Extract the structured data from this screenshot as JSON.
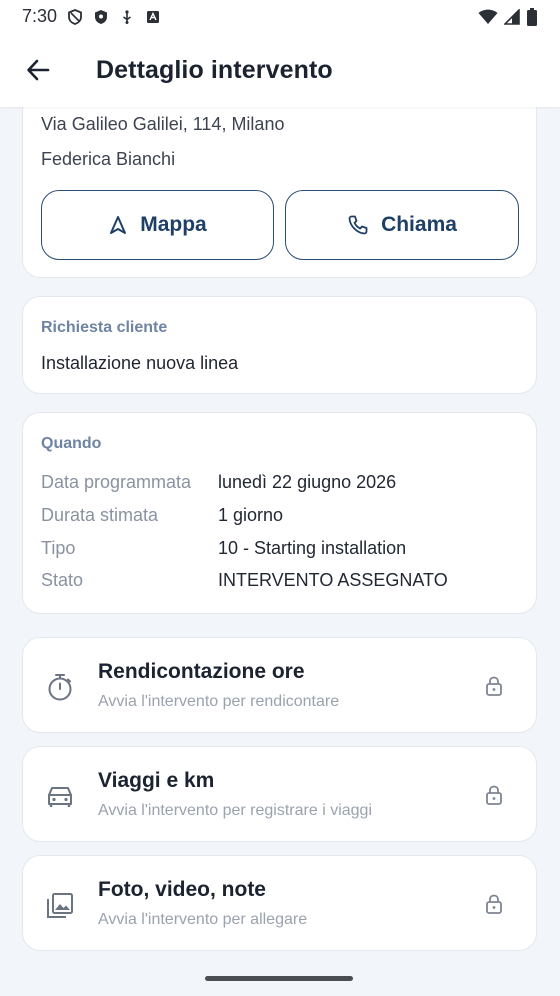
{
  "status_bar": {
    "time": "7:30"
  },
  "app_bar": {
    "title": "Dettaglio intervento"
  },
  "top_card": {
    "address": "Via Galileo Galilei, 114, Milano",
    "contact": "Federica Bianchi",
    "map_button": "Mappa",
    "call_button": "Chiama"
  },
  "request_card": {
    "label": "Richiesta cliente",
    "text": "Installazione nuova linea"
  },
  "when_card": {
    "label": "Quando",
    "rows": [
      {
        "key": "Data programmata",
        "value": "lunedì 22 giugno 2026"
      },
      {
        "key": "Durata stimata",
        "value": "1 giorno"
      },
      {
        "key": "Tipo",
        "value": "10 - Starting installation"
      },
      {
        "key": "Stato",
        "value": "INTERVENTO ASSEGNATO"
      }
    ]
  },
  "actions": [
    {
      "title": "Rendicontazione ore",
      "subtitle": "Avvia l'intervento per rendicontare",
      "icon": "stopwatch-icon"
    },
    {
      "title": "Viaggi e km",
      "subtitle": "Avvia l'intervento per registrare i viaggi",
      "icon": "car-icon"
    },
    {
      "title": "Foto, video, note",
      "subtitle": "Avvia l'intervento per allegare",
      "icon": "gallery-icon"
    }
  ]
}
